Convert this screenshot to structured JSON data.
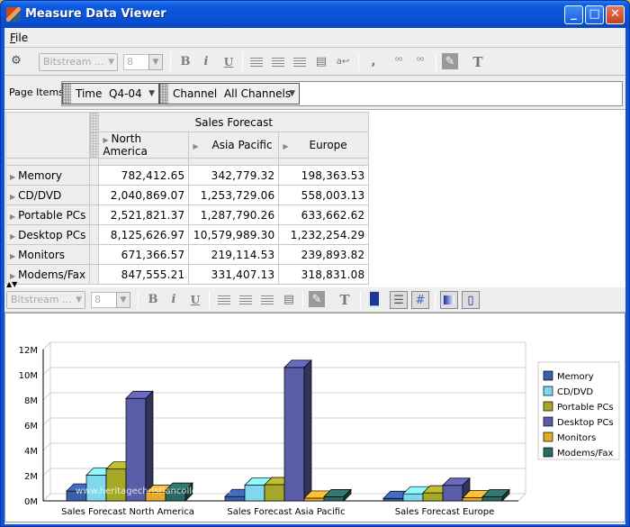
{
  "window": {
    "title": "Measure Data Viewer",
    "controls": {
      "minimize": "_",
      "maximize": "□",
      "close": "✕"
    }
  },
  "menubar": {
    "items": [
      {
        "label": "File",
        "mnemonic": "F"
      }
    ]
  },
  "toolbar_top": {
    "font_combo": "Bitstream ...",
    "size_combo": "8",
    "icons": [
      "help-wizard-icon",
      "bold-icon",
      "italic-icon",
      "underline-icon",
      "align-left-icon",
      "align-center-icon",
      "align-right-icon",
      "format-cell-icon",
      "wrap-text-icon",
      "comma-format-icon",
      "increase-decimal-icon",
      "decrease-decimal-icon",
      "fill-color-icon",
      "text-color-icon"
    ],
    "bold": "B",
    "italic": "i",
    "underline": "U",
    "comma": ",",
    "wrap": "a↩"
  },
  "page_items": {
    "label": "Page Items",
    "items": [
      {
        "dimension": "Time",
        "value": "Q4-04"
      },
      {
        "dimension": "Channel",
        "value": "All Channels"
      }
    ]
  },
  "crosstab": {
    "measure": "Sales Forecast",
    "columns": [
      "North America",
      "Asia Pacific",
      "Europe"
    ],
    "rows": [
      {
        "label": "Memory",
        "values": [
          "782,412.65",
          "342,779.32",
          "198,363.53"
        ]
      },
      {
        "label": "CD/DVD",
        "values": [
          "2,040,869.07",
          "1,253,729.06",
          "558,003.13"
        ]
      },
      {
        "label": "Portable PCs",
        "values": [
          "2,521,821.37",
          "1,287,790.26",
          "633,662.62"
        ]
      },
      {
        "label": "Desktop PCs",
        "values": [
          "8,125,626.97",
          "10,579,989.30",
          "1,232,254.29"
        ]
      },
      {
        "label": "Monitors",
        "values": [
          "671,366.57",
          "219,114.53",
          "239,893.82"
        ]
      },
      {
        "label": "Modems/Fax",
        "values": [
          "847,555.21",
          "331,407.13",
          "318,831.08"
        ]
      }
    ]
  },
  "splitter": {
    "label": "▲▼"
  },
  "toolbar_bottom": {
    "font_combo": "Bitstream ...",
    "size_combo": "8",
    "bold": "B",
    "italic": "i",
    "underline": "U"
  },
  "colors": {
    "Memory": "#3a5fa8",
    "CD/DVD": "#7fd8ee",
    "Portable PCs": "#a8a828",
    "Desktop PCs": "#5a5ea8",
    "Monitors": "#e8a82a",
    "Modems/Fax": "#2a6a64"
  },
  "watermark": "www.heritagechristiancollege.com",
  "chart_data": {
    "type": "bar",
    "style": "3d-clustered",
    "title": "",
    "xlabel": "",
    "ylabel": "",
    "categories": [
      "Sales Forecast North America",
      "Sales Forecast Asia Pacific",
      "Sales Forecast Europe"
    ],
    "series": [
      {
        "name": "Memory",
        "values": [
          782412.65,
          342779.32,
          198363.53
        ]
      },
      {
        "name": "CD/DVD",
        "values": [
          2040869.07,
          1253729.06,
          558003.13
        ]
      },
      {
        "name": "Portable PCs",
        "values": [
          2521821.37,
          1287790.26,
          633662.62
        ]
      },
      {
        "name": "Desktop PCs",
        "values": [
          8125626.97,
          10579989.3,
          1232254.29
        ]
      },
      {
        "name": "Monitors",
        "values": [
          671366.57,
          219114.53,
          239893.82
        ]
      },
      {
        "name": "Modems/Fax",
        "values": [
          847555.21,
          331407.13,
          318831.08
        ]
      }
    ],
    "yticks": [
      "0M",
      "2M",
      "4M",
      "6M",
      "8M",
      "10M",
      "12M"
    ],
    "ylim": [
      0,
      12000000
    ],
    "grid": true,
    "legend": "right"
  }
}
